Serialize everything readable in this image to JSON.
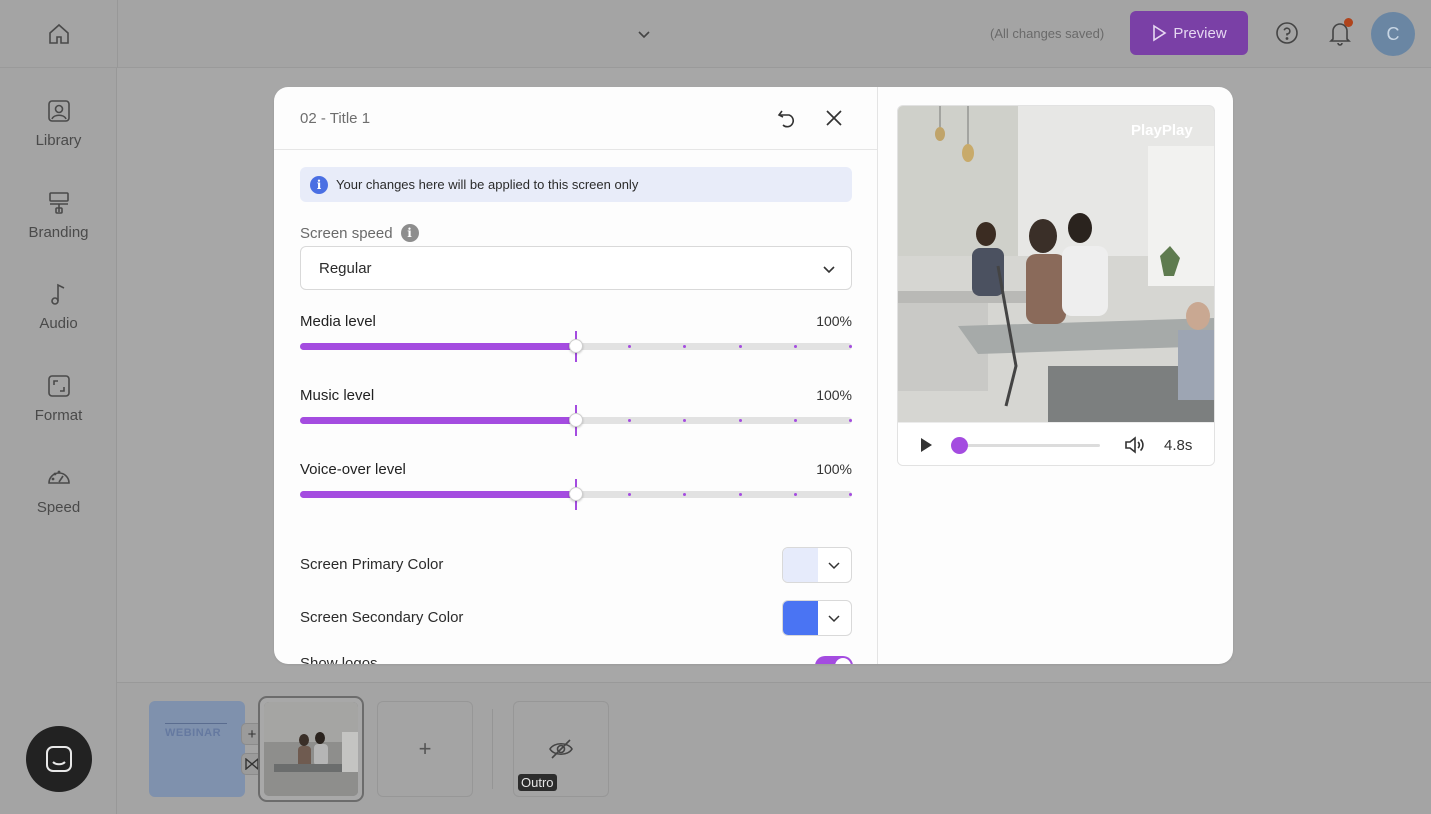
{
  "topbar": {
    "save_status": "(All changes saved)",
    "preview_label": "Preview",
    "avatar_initial": "C"
  },
  "sidebar": {
    "items": [
      {
        "label": "Library",
        "icon": "library-icon"
      },
      {
        "label": "Branding",
        "icon": "branding-icon"
      },
      {
        "label": "Audio",
        "icon": "music-note-icon"
      },
      {
        "label": "Format",
        "icon": "format-icon"
      },
      {
        "label": "Speed",
        "icon": "speedometer-icon"
      }
    ]
  },
  "modal": {
    "title": "02 - Title 1",
    "info_text": "Your changes here will be applied to this screen only",
    "screen_speed_label": "Screen speed",
    "screen_speed_value": "Regular",
    "levels": [
      {
        "label": "Media level",
        "value": "100%",
        "fraction": 0.5
      },
      {
        "label": "Music level",
        "value": "100%",
        "fraction": 0.5
      },
      {
        "label": "Voice-over level",
        "value": "100%",
        "fraction": 0.5
      }
    ],
    "colors": [
      {
        "label": "Screen Primary Color",
        "color": "#e6ebfb"
      },
      {
        "label": "Screen Secondary Color",
        "color": "#4a74f3"
      }
    ],
    "show_logos_label": "Show logos",
    "show_logos_on": true,
    "accent": "#a44ce0"
  },
  "preview": {
    "watermark": "PlayPlay",
    "duration": "4.8s",
    "progress": 0.0
  },
  "filmstrip": {
    "webinar_text": "WEBINAR",
    "outro_label": "Outro"
  }
}
